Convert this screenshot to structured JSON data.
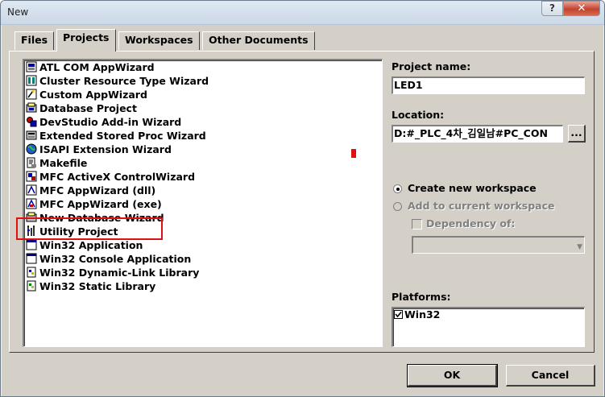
{
  "window": {
    "title": "New",
    "help_label": "?",
    "close_label": "✕"
  },
  "tabs": [
    {
      "label": "Files"
    },
    {
      "label": "Projects"
    },
    {
      "label": "Workspaces"
    },
    {
      "label": "Other Documents"
    }
  ],
  "active_tab": "Projects",
  "projects": [
    {
      "label": "ATL COM AppWizard",
      "icon": "atl-icon"
    },
    {
      "label": "Cluster Resource Type Wizard",
      "icon": "cluster-icon"
    },
    {
      "label": "Custom AppWizard",
      "icon": "custom-wizard-icon"
    },
    {
      "label": "Database Project",
      "icon": "database-icon"
    },
    {
      "label": "DevStudio Add-in Wizard",
      "icon": "addin-icon"
    },
    {
      "label": "Extended Stored Proc Wizard",
      "icon": "stored-proc-icon"
    },
    {
      "label": "ISAPI Extension Wizard",
      "icon": "globe-icon"
    },
    {
      "label": "Makefile",
      "icon": "makefile-icon"
    },
    {
      "label": "MFC ActiveX ControlWizard",
      "icon": "activex-icon"
    },
    {
      "label": "MFC AppWizard (dll)",
      "icon": "mfc-dll-icon"
    },
    {
      "label": "MFC AppWizard (exe)",
      "icon": "mfc-exe-icon"
    },
    {
      "label": "New Database Wizard",
      "icon": "new-database-icon"
    },
    {
      "label": "Utility Project",
      "icon": "utility-icon"
    },
    {
      "label": "Win32 Application",
      "icon": "win32-app-icon"
    },
    {
      "label": "Win32 Console Application",
      "icon": "console-icon"
    },
    {
      "label": "Win32 Dynamic-Link Library",
      "icon": "dll-icon"
    },
    {
      "label": "Win32 Static Library",
      "icon": "static-lib-icon"
    }
  ],
  "highlighted_item": "MFC AppWizard (exe)",
  "form": {
    "project_name_label": "Project name:",
    "project_name_value": "LED1",
    "location_label": "Location:",
    "location_value": "D:#_PLC_4차_김일남#PC_CON",
    "browse_label": "...",
    "create_workspace_label": "Create new workspace",
    "add_workspace_label": "Add to current workspace",
    "dependency_label": "Dependency of:",
    "platforms_label": "Platforms:",
    "platform_win32": "Win32"
  },
  "buttons": {
    "ok": "OK",
    "cancel": "Cancel"
  },
  "colors": {
    "highlight_box": "#e01010",
    "dialog_bg": "#d4d0c8",
    "close_red": "#c4422f"
  }
}
